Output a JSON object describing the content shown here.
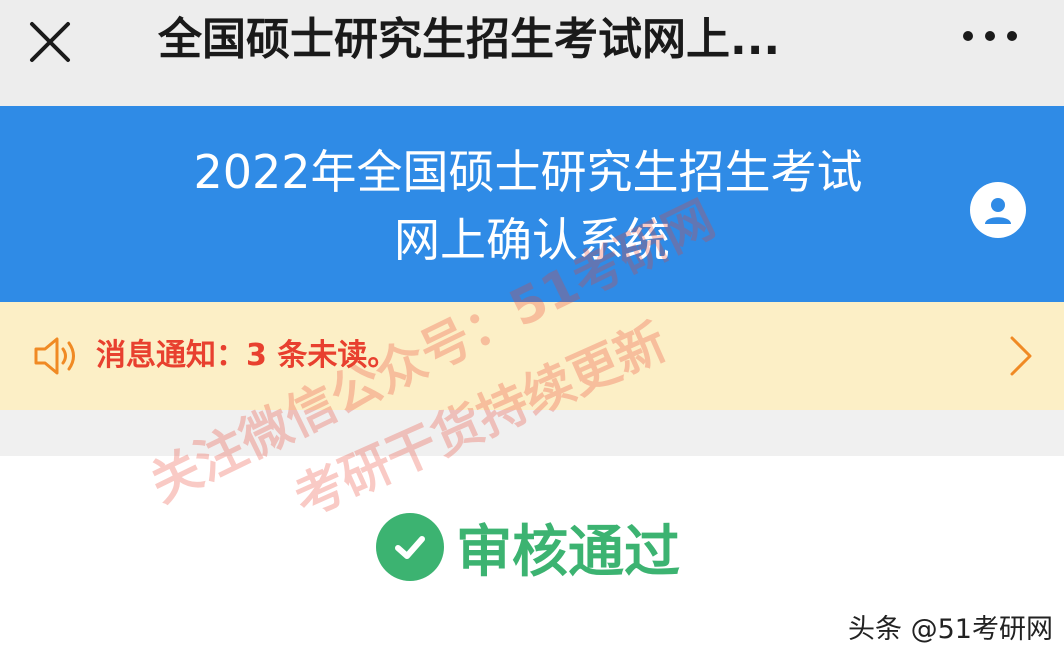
{
  "navbar": {
    "title": "全国硕士研究生招生考试网上...",
    "close_icon": "close-icon",
    "more_icon": "more-icon"
  },
  "banner": {
    "title_line1": "2022年全国硕士研究生招生考试",
    "title_line2": "网上确认系统",
    "user_icon": "user-icon"
  },
  "notice": {
    "text": "消息通知：3 条未读。",
    "speaker_icon": "speaker-icon",
    "arrow_icon": "chevron-right-icon"
  },
  "status": {
    "text": "审核通过",
    "icon": "check-circle-icon"
  },
  "watermark": {
    "line1": "关注微信公众号：51考研网",
    "line2": "考研干货持续更新"
  },
  "source_label": "头条 @51考研网",
  "colors": {
    "banner": "#2f8be6",
    "notice_bg": "#fcefc6",
    "notice_text": "#e8402f",
    "status_green": "#3cb371"
  }
}
